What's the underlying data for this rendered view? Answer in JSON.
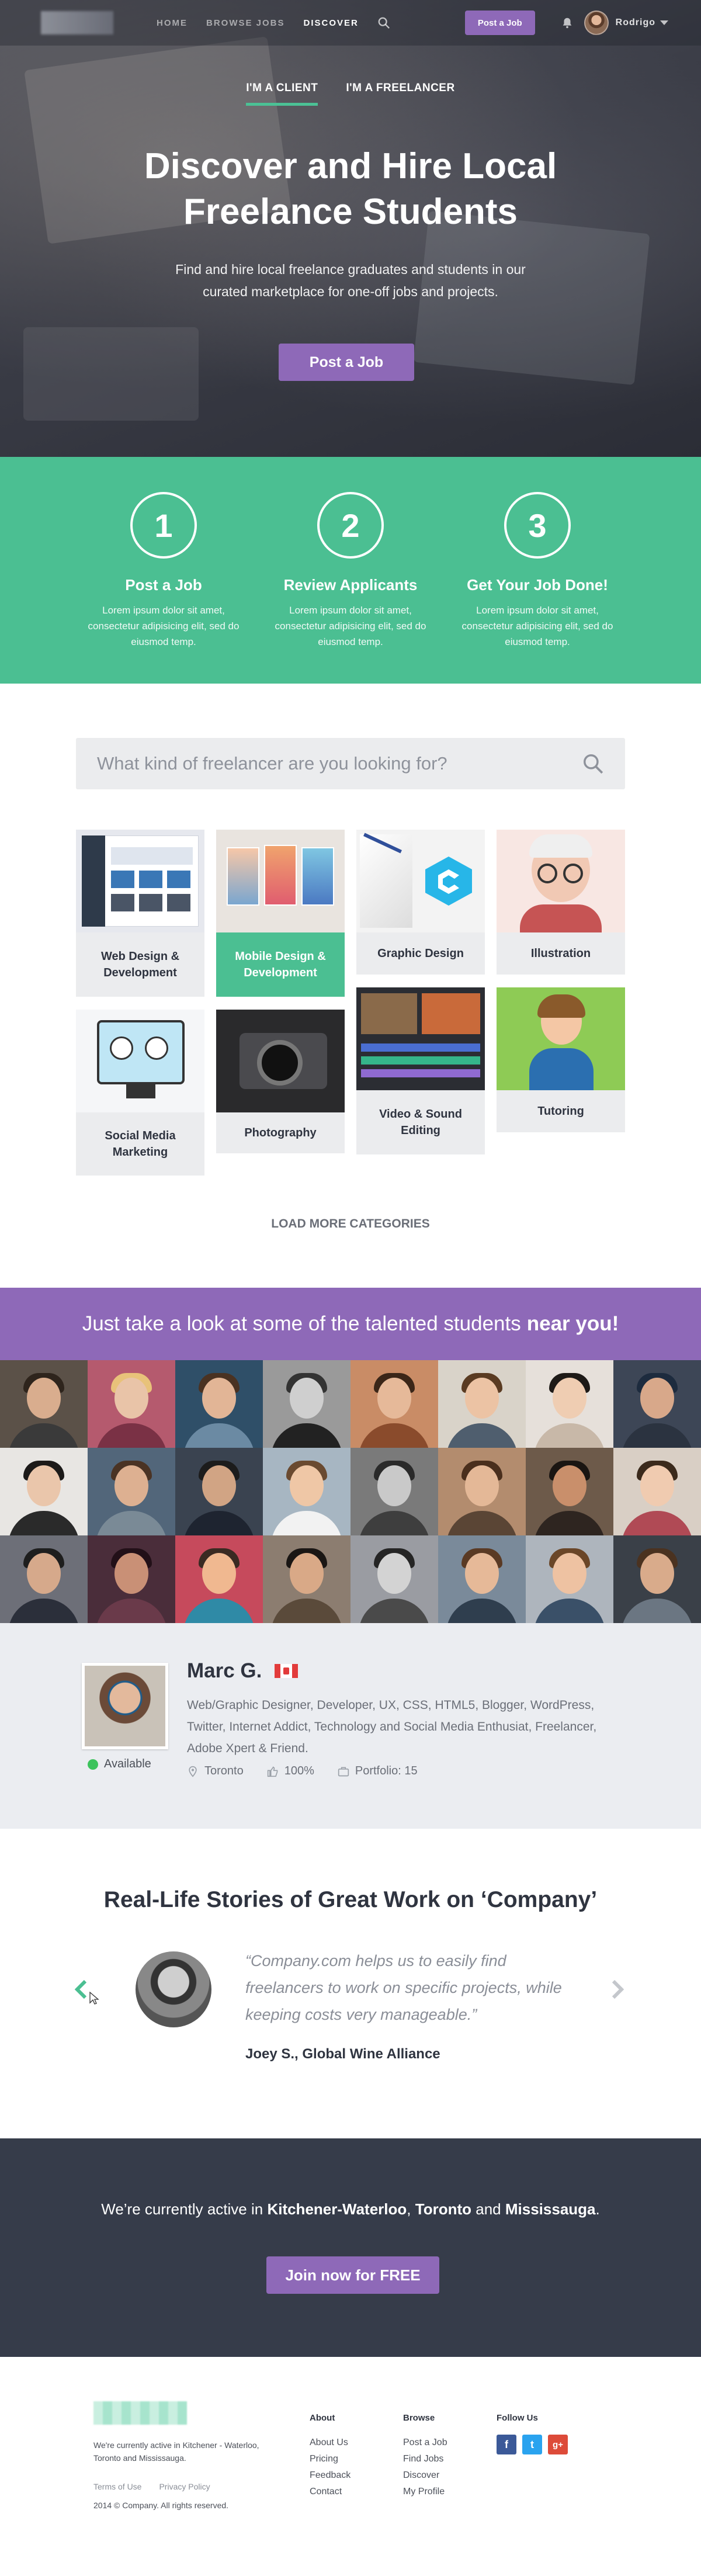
{
  "nav": {
    "links": [
      "HOME",
      "BROWSE JOBS",
      "DISCOVER"
    ],
    "post_job": "Post a Job",
    "user": "Rodrigo"
  },
  "hero": {
    "tabs": [
      "I'M A CLIENT",
      "I'M A FREELANCER"
    ],
    "title": "Discover and Hire Local Freelance Students",
    "subtitle": "Find and hire local freelance graduates and students in our curated marketplace for one-off jobs and projects.",
    "cta": "Post a Job"
  },
  "steps": [
    {
      "num": "1",
      "title": "Post a Job",
      "text": "Lorem ipsum dolor sit amet, consectetur adipisicing elit, sed do eiusmod temp."
    },
    {
      "num": "2",
      "title": "Review Applicants",
      "text": "Lorem ipsum dolor sit amet, consectetur adipisicing elit, sed do eiusmod temp."
    },
    {
      "num": "3",
      "title": "Get Your Job Done!",
      "text": "Lorem ipsum dolor sit amet, consectetur adipisicing elit, sed do eiusmod temp."
    }
  ],
  "search": {
    "placeholder": "What kind of freelancer are you looking for?"
  },
  "categories": [
    {
      "label": "Web Design & Development",
      "selected": false
    },
    {
      "label": "Mobile Design & Development",
      "selected": true
    },
    {
      "label": "Graphic Design",
      "selected": false
    },
    {
      "label": "Illustration",
      "selected": false
    },
    {
      "label": "Social Media Marketing",
      "selected": false
    },
    {
      "label": "Photography",
      "selected": false
    },
    {
      "label": "Video & Sound Editing",
      "selected": false
    },
    {
      "label": "Tutoring",
      "selected": false
    }
  ],
  "load_more": "LOAD MORE CATEGORIES",
  "students": {
    "banner_prefix": "Just take a look at some of the talented students",
    "banner_bold": "near you!"
  },
  "profile": {
    "name": "Marc G.",
    "status": "Available",
    "bio": "Web/Graphic Designer, Developer, UX, CSS, HTML5, Blogger, WordPress, Twitter, Internet Addict, Technology and Social Media Enthusiat, Freelancer, Adobe Xpert & Friend.",
    "location": "Toronto",
    "rating": "100%",
    "portfolio": "Portfolio: 15"
  },
  "stories": {
    "title": "Real-Life Stories of Great Work on ‘Company’",
    "quote": "“Company.com helps us to easily find freelancers to work on specific projects, while keeping costs very manageable.”",
    "author": "Joey S., Global Wine Alliance"
  },
  "cities": {
    "prefix": "We’re currently active in",
    "city1": "Kitchener-Waterloo",
    "sep1": ",",
    "city2": "Toronto",
    "and": "and",
    "city3": "Mississauga",
    "end": ".",
    "cta": "Join now for FREE"
  },
  "footer": {
    "desc": "We're currently active in Kitchener - Waterloo, Toronto and Mississauga.",
    "terms": "Terms of Use",
    "privacy": "Privacy Policy",
    "copyright": "2014 © Company. All rights reserved.",
    "about": {
      "heading": "About",
      "links": [
        "About Us",
        "Pricing",
        "Feedback",
        "Contact"
      ]
    },
    "browse": {
      "heading": "Browse",
      "links": [
        "Post a Job",
        "Find Jobs",
        "Discover",
        "My Profile"
      ]
    },
    "follow": {
      "heading": "Follow Us",
      "icons": [
        "facebook-icon",
        "twitter-icon",
        "google-plus-icon"
      ]
    }
  },
  "colors": {
    "green": "#4bbf92",
    "purple": "#8e69b8",
    "dark": "#363c4a",
    "light": "#ebecee"
  }
}
